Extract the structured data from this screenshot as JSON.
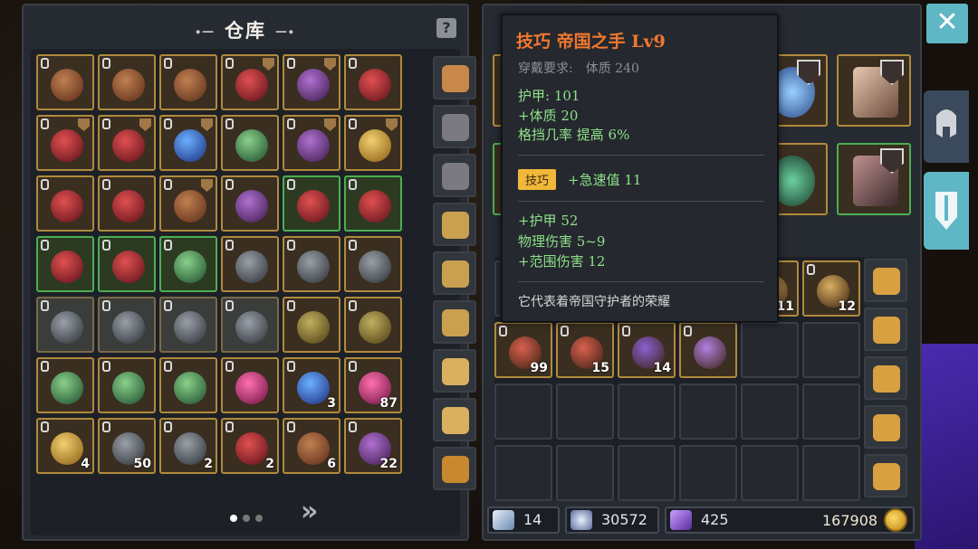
{
  "warehouse": {
    "title": "仓库",
    "help_label": "?",
    "next_page_label": "»",
    "pages": 3,
    "current_page": 1,
    "rows": [
      [
        {
          "c": ""
        },
        {
          "c": ""
        },
        {
          "c": ""
        },
        {
          "c": ""
        },
        {
          "c": ""
        },
        {
          "c": ""
        }
      ],
      [
        {
          "c": ""
        },
        {
          "c": ""
        },
        {
          "c": ""
        },
        {
          "c": ""
        },
        {
          "c": ""
        },
        {
          "c": ""
        }
      ],
      [
        {
          "c": ""
        },
        {
          "c": ""
        },
        {
          "c": ""
        },
        {
          "c": ""
        },
        {
          "c": ""
        },
        {
          "c": ""
        }
      ],
      [
        {
          "c": ""
        },
        {
          "c": ""
        },
        {
          "c": ""
        },
        {
          "c": ""
        },
        {
          "c": ""
        },
        {
          "c": ""
        }
      ],
      [
        {
          "c": ""
        },
        {
          "c": ""
        },
        {
          "c": ""
        },
        {
          "c": ""
        },
        {
          "c": ""
        },
        {
          "c": ""
        }
      ],
      [
        {
          "c": ""
        },
        {
          "c": ""
        },
        {
          "c": ""
        },
        {
          "c": ""
        },
        {
          "c": "3"
        },
        {
          "c": "87"
        }
      ],
      [
        {
          "c": "4"
        },
        {
          "c": "50"
        },
        {
          "c": "2"
        },
        {
          "c": "2"
        },
        {
          "c": "6"
        },
        {
          "c": "22"
        }
      ]
    ]
  },
  "inventory": {
    "counts": [
      "11",
      "12",
      "99",
      "15",
      "14"
    ]
  },
  "tooltip": {
    "title": "技巧 帝国之手 Lv9",
    "requirement_label": "穿戴要求:",
    "requirement_value": "体质 240",
    "stats": [
      "护甲: 101",
      "+体质 20",
      "格挡几率 提高 6%"
    ],
    "bonus_badge": "技巧",
    "bonus_text": "+急速值 11",
    "extra_stats": [
      "+护甲 52",
      "物理伤害 5~9",
      "+范围伤害 12"
    ],
    "description": "它代表着帝国守护者的荣耀"
  },
  "currency": {
    "wand": "14",
    "crystal": "30572",
    "gem": "425",
    "gold": "167908"
  },
  "close_label": "✕",
  "colors": {
    "accent": "#5fb7c6",
    "tooltip_title": "#f07830",
    "stat_green": "#8ee08a",
    "slot_border_gold": "#b08a3c",
    "slot_border_green": "#4caf50"
  }
}
